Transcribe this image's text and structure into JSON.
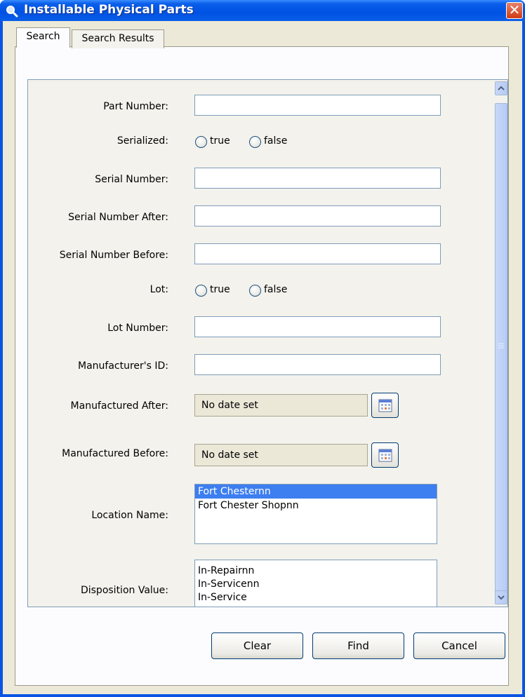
{
  "window": {
    "title": "Installable Physical Parts",
    "close_label": "✕"
  },
  "tabs": [
    {
      "label": "Search"
    },
    {
      "label": "Search Results"
    }
  ],
  "form": {
    "part_number_label": "Part Number:",
    "serialized_label": "Serialized:",
    "serial_number_label": "Serial Number:",
    "serial_after_label": "Serial Number After:",
    "serial_before_label": "Serial Number Before:",
    "lot_label": "Lot:",
    "lot_number_label": "Lot Number:",
    "manufacturer_id_label": "Manufacturer's ID:",
    "manufactured_after_label": "Manufactured After:",
    "manufactured_before_label": "Manufactured Before:",
    "location_name_label": "Location Name:",
    "disposition_value_label": "Disposition Value:",
    "radio_true": "true",
    "radio_false": "false",
    "date_placeholder": "No date set"
  },
  "location_options": [
    "Fort Chesternn",
    "Fort Chester Shopnn"
  ],
  "disposition_options": [
    "In-Repairnn",
    "In-Servicenn",
    "In-Service"
  ],
  "buttons": {
    "clear": "Clear",
    "find": "Find",
    "cancel": "Cancel"
  },
  "colors": {
    "titlebar": "#0a5ee9",
    "selection": "#3d7ef0",
    "dialog_bg": "#ece9d8"
  }
}
